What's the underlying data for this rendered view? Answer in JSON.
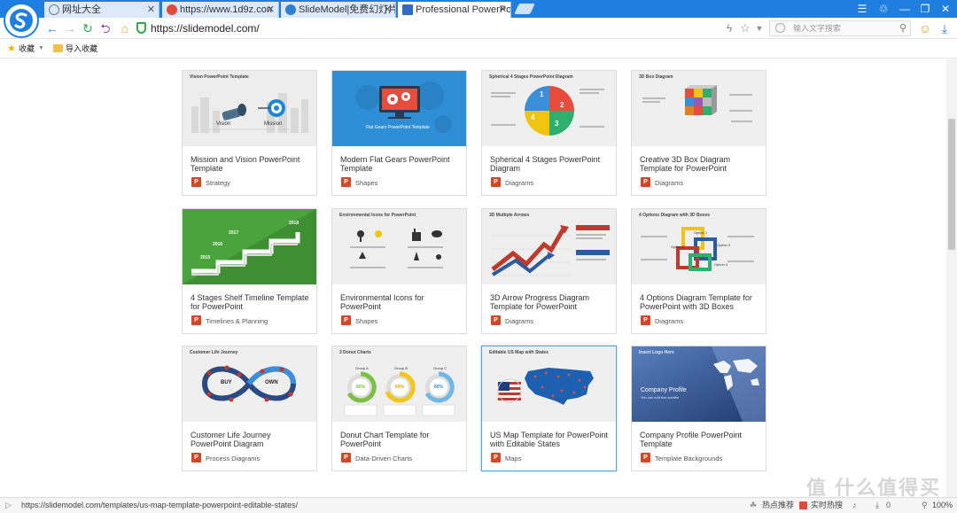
{
  "browser": {
    "tabs": [
      {
        "label": "网址大全",
        "icon": "globe-icon",
        "color": "#7a8aa0"
      },
      {
        "label": "https://www.1d9z.con",
        "icon": "s-logo-icon",
        "color": "#e04b3a"
      },
      {
        "label": "SlideModel|免费幻灯片",
        "icon": "e-logo-icon",
        "color": "#2f7fd0"
      },
      {
        "label": "Professional PowerPo",
        "icon": "ppt-icon",
        "color": "#2e6cc4"
      }
    ],
    "url": "https://slidemodel.com/",
    "search_placeholder": "输入文字搜索",
    "bookmarks": {
      "favorites": "收藏",
      "import": "导入收藏"
    },
    "accent": "#1f7fe0"
  },
  "cards": [
    {
      "title": "Mission and Vision PowerPoint Template",
      "category": "Strategy",
      "thumb_label": "Vision PowerPoint Template",
      "thumb_texts": [
        "Vision",
        "Mission"
      ]
    },
    {
      "title": "Modern Flat Gears PowerPoint Template",
      "category": "Shapes",
      "thumb_label": "",
      "thumb_texts": [
        "Flat Gears PowerPoint Template"
      ]
    },
    {
      "title": "Spherical 4 Stages PowerPoint Diagram",
      "category": "Diagrams",
      "thumb_label": "Spherical 4 Stages PowerPoint Diagram",
      "thumb_texts": [
        "1",
        "2",
        "3",
        "4"
      ]
    },
    {
      "title": "Creative 3D Box Diagram Template for PowerPoint",
      "category": "Diagrams",
      "thumb_label": "3D Box Diagram",
      "thumb_texts": []
    },
    {
      "title": "4 Stages Shelf Timeline Template for PowerPoint",
      "category": "Timelines & Planning",
      "thumb_label": "",
      "thumb_texts": [
        "2015",
        "2016",
        "2017",
        "2018"
      ]
    },
    {
      "title": "Environmental Icons for PowerPoint",
      "category": "Shapes",
      "thumb_label": "Environmental Icons for PowerPoint",
      "thumb_texts": []
    },
    {
      "title": "3D Arrow Progress Diagram Template for PowerPoint",
      "category": "Diagrams",
      "thumb_label": "3D Multiple Arrows",
      "thumb_texts": []
    },
    {
      "title": "4 Options Diagram Template for PowerPoint with 3D Boxes",
      "category": "Diagrams",
      "thumb_label": "4 Options Diagram with 3D Boxes",
      "thumb_texts": [
        "Option 1",
        "Option 2",
        "Option 3",
        "Option 4"
      ]
    },
    {
      "title": "Customer Life Journey PowerPoint Diagram",
      "category": "Process Diagrams",
      "thumb_label": "Customer Life Journey",
      "thumb_texts": [
        "BUY",
        "OWN"
      ]
    },
    {
      "title": "Donut Chart Template for PowerPoint",
      "category": "Data-Driven Charts",
      "thumb_label": "3 Donut Charts",
      "thumb_texts": [
        "Group A",
        "Group B",
        "Group C",
        "80%",
        "60%",
        "80%"
      ]
    },
    {
      "title": "US Map Template for PowerPoint with Editable States",
      "category": "Maps",
      "thumb_label": "Editable US Map with States",
      "thumb_texts": []
    },
    {
      "title": "Company Profile PowerPoint Template",
      "category": "Template Backgrounds",
      "thumb_label": "Insert Logo Here",
      "thumb_texts": [
        "Company Profile",
        "You can edit this subtitle"
      ]
    }
  ],
  "status_bar": {
    "url": "https://slidemodel.com/templates/us-map-template-powerpoint-editable-states/",
    "hot_recommend": "热点推荐",
    "realtime_hot": "实时热搜",
    "zoom": "100%"
  },
  "watermark": "值 什么值得买"
}
